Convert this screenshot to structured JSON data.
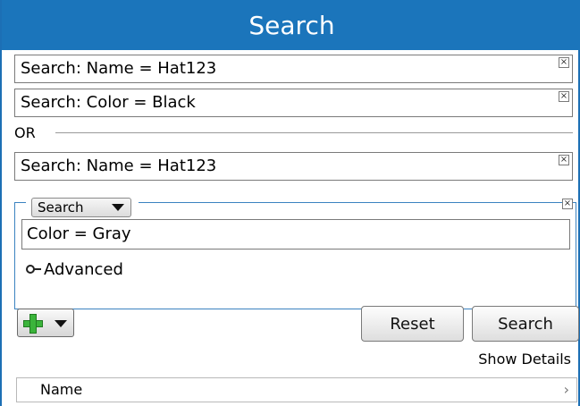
{
  "title": "Search",
  "criteria": [
    {
      "text": "Search: Name = Hat123",
      "close": "×"
    },
    {
      "text": "Search: Color = Black",
      "close": "×"
    }
  ],
  "or_label": "OR",
  "criteria_after_or": [
    {
      "text": "Search: Name = Hat123",
      "close": "×"
    }
  ],
  "group": {
    "select_value": "Search",
    "input_value": "Color = Gray",
    "advanced_label": "Advanced",
    "close": "×"
  },
  "toolbar": {
    "reset_label": "Reset",
    "search_label": "Search",
    "show_details_label": "Show Details"
  },
  "grid": {
    "columns": [
      "Name"
    ],
    "chevron": "›"
  },
  "colors": {
    "accent": "#1b75bb",
    "add_icon": "#3bb43b"
  },
  "icons": [
    "close-icon",
    "chevron-down-icon",
    "plus-icon",
    "expand-toggle-icon",
    "chevron-right-icon"
  ]
}
